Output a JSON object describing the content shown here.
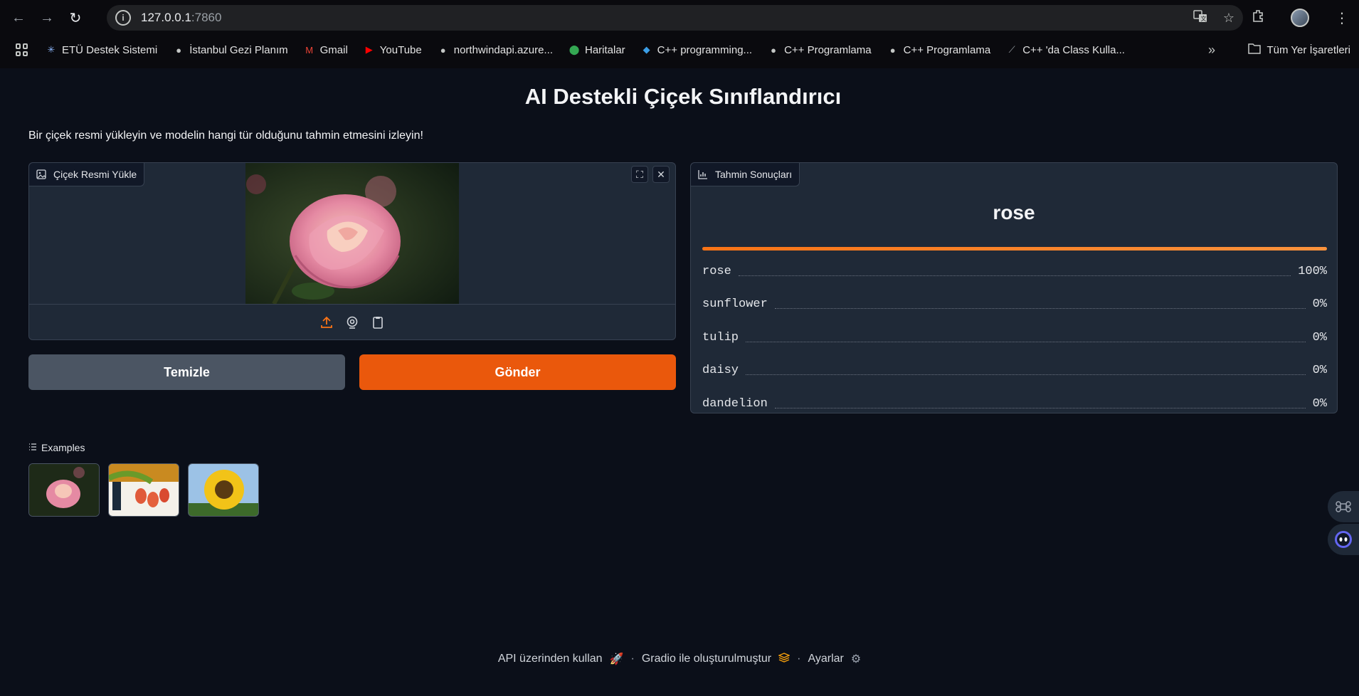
{
  "browser": {
    "url_host": "127.0.0.1",
    "url_port": ":7860",
    "bookmarks": [
      {
        "label": "ETÜ Destek Sistemi",
        "icon": "snowflake-icon",
        "color": "#8ab4f8"
      },
      {
        "label": "İstanbul Gezi Planım",
        "icon": "globe-icon",
        "color": "#c4c7c5"
      },
      {
        "label": "Gmail",
        "icon": "gmail-icon",
        "color": "#ea4335"
      },
      {
        "label": "YouTube",
        "icon": "youtube-icon",
        "color": "#ff0000"
      },
      {
        "label": "northwindapi.azure...",
        "icon": "globe-icon",
        "color": "#c4c7c5"
      },
      {
        "label": "Haritalar",
        "icon": "maps-icon",
        "color": "#34a853"
      },
      {
        "label": "C++ programming...",
        "icon": "vscode-icon",
        "color": "#3b9ee6"
      },
      {
        "label": "C++ Programlama",
        "icon": "globe-icon",
        "color": "#c4c7c5"
      },
      {
        "label": "C++ Programlama",
        "icon": "globe-icon",
        "color": "#c4c7c5"
      },
      {
        "label": "C++ 'da Class Kulla...",
        "icon": "link-icon",
        "color": "#9aa0a6"
      }
    ],
    "all_bookmarks": "Tüm Yer İşaretleri"
  },
  "app": {
    "title": "AI Destekli Çiçek Sınıflandırıcı",
    "description": "Bir çiçek resmi yükleyin ve modelin hangi tür olduğunu tahmin etmesini izleyin!",
    "image_label": "Çiçek Resmi Yükle",
    "clear_label": "Temizle",
    "submit_label": "Gönder",
    "result_label": "Tahmin Sonuçları",
    "top_prediction": "rose",
    "predictions": [
      {
        "label": "rose",
        "value": "100%",
        "fraction": 1.0
      },
      {
        "label": "sunflower",
        "value": "0%",
        "fraction": 0
      },
      {
        "label": "tulip",
        "value": "0%",
        "fraction": 0
      },
      {
        "label": "daisy",
        "value": "0%",
        "fraction": 0
      },
      {
        "label": "dandelion",
        "value": "0%",
        "fraction": 0
      }
    ],
    "examples_label": "Examples",
    "accent": "#ea580c"
  },
  "footer": {
    "api": "API üzerinden kullan",
    "gradio": "Gradio ile oluşturulmuştur",
    "settings": "Ayarlar"
  }
}
